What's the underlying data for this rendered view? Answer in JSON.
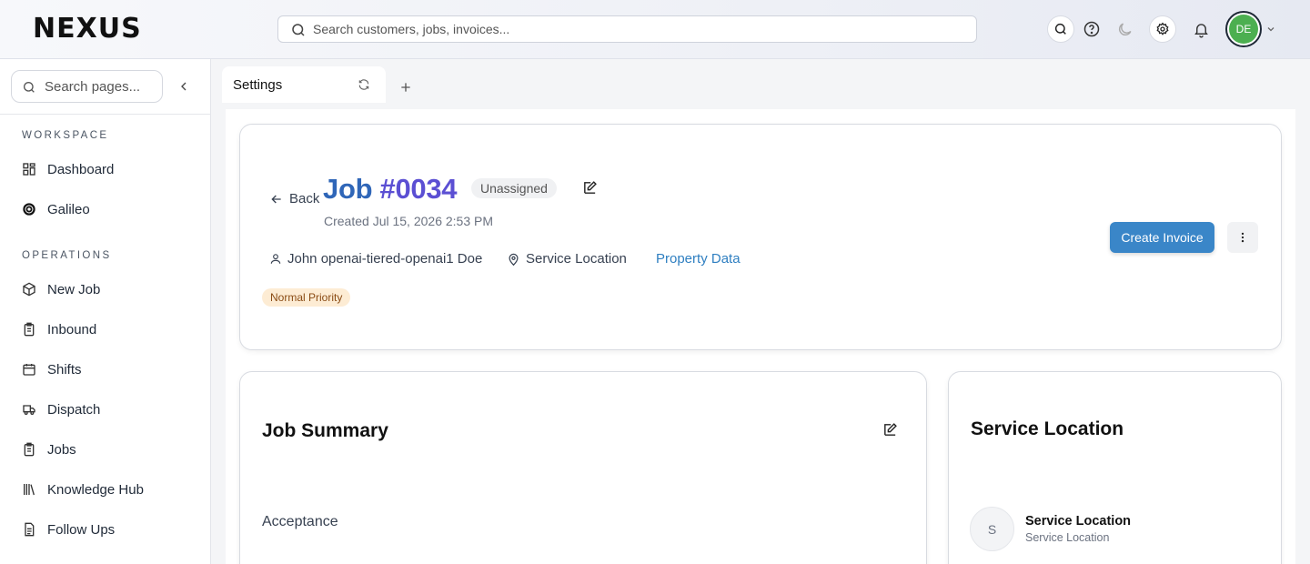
{
  "app": {
    "logo_text": "NEXUS"
  },
  "header": {
    "search_placeholder": "Search customers, jobs, invoices...",
    "user_initials": "DE",
    "icons": [
      "search-icon",
      "help-icon",
      "moon-icon",
      "gear-icon",
      "bell-icon",
      "chevron-down-icon"
    ]
  },
  "sidebar": {
    "search_placeholder": "Search pages...",
    "sections": [
      {
        "title": "WORKSPACE",
        "items": [
          {
            "label": "Dashboard",
            "icon": "dashboard-icon"
          },
          {
            "label": "Galileo",
            "icon": "galileo-icon"
          }
        ]
      },
      {
        "title": "OPERATIONS",
        "items": [
          {
            "label": "New Job",
            "icon": "new-job-icon"
          },
          {
            "label": "Inbound",
            "icon": "inbound-icon"
          },
          {
            "label": "Shifts",
            "icon": "calendar-icon"
          },
          {
            "label": "Dispatch",
            "icon": "truck-icon"
          },
          {
            "label": "Jobs",
            "icon": "clipboard-icon"
          },
          {
            "label": "Knowledge Hub",
            "icon": "library-icon"
          },
          {
            "label": "Follow Ups",
            "icon": "document-icon"
          }
        ]
      }
    ]
  },
  "tabs": [
    {
      "label": "Settings"
    }
  ],
  "job": {
    "back_label": "Back",
    "number_prefix": "Job ",
    "number": "#0034",
    "assignment": "Unassigned",
    "created": "Created Jul 15, 2026 2:53 PM",
    "customer": "John openai-tiered-openai1 Doe",
    "location": "Service Location",
    "property_link": "Property Data",
    "priority": "Normal Priority",
    "create_invoice_label": "Create Invoice"
  },
  "summary": {
    "title": "Job Summary",
    "first_field": "Acceptance"
  },
  "service_location": {
    "title": "Service Location",
    "avatar_letter": "S",
    "name": "Service Location",
    "subtitle": "Service Location"
  },
  "colors": {
    "accent": "#3a86c8",
    "title_blue": "#2f66b8",
    "title_purple": "#5b4fd3",
    "priority_bg": "#fdecd4",
    "avatar_green": "#4caf50"
  }
}
